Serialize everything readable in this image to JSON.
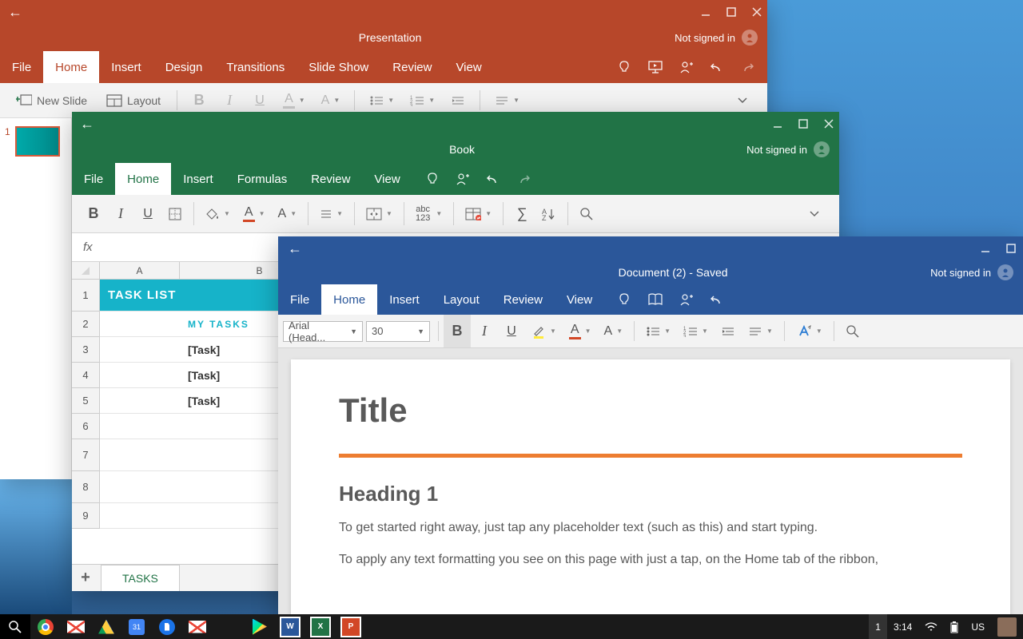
{
  "powerpoint": {
    "title": "Presentation",
    "signed": "Not signed in",
    "tabs": {
      "file": "File",
      "home": "Home",
      "insert": "Insert",
      "design": "Design",
      "transitions": "Transitions",
      "slideshow": "Slide Show",
      "review": "Review",
      "view": "View"
    },
    "new_slide": "New Slide",
    "layout": "Layout",
    "slide_number": "1"
  },
  "excel": {
    "title": "Book",
    "signed": "Not signed in",
    "tabs": {
      "file": "File",
      "home": "Home",
      "insert": "Insert",
      "formulas": "Formulas",
      "review": "Review",
      "view": "View"
    },
    "fx_label": "fx",
    "abc123": "abc\n123",
    "cols": {
      "a": "A",
      "b": "B"
    },
    "rows": {
      "r1": "1",
      "r2": "2",
      "r3": "3",
      "r4": "4",
      "r5": "5",
      "r6": "6",
      "r7": "7",
      "r8": "8",
      "r9": "9"
    },
    "task_list_header": "TASK LIST",
    "my_tasks": "MY  TASKS",
    "task": "[Task]",
    "sheet_name": "TASKS",
    "plus": "+"
  },
  "word": {
    "title": "Document (2)  -  Saved",
    "signed": "Not signed in",
    "tabs": {
      "file": "File",
      "home": "Home",
      "insert": "Insert",
      "layout": "Layout",
      "review": "Review",
      "view": "View"
    },
    "font_name": "Arial (Head...",
    "font_size": "30",
    "doc_title": "Title",
    "heading1": "Heading 1",
    "para1": "To get started right away, just tap any placeholder text (such as this) and start typing.",
    "para2": "To apply any text formatting you see on this page with just a tap, on the Home tab of the ribbon,"
  },
  "taskbar": {
    "cal_day": "31",
    "notif": "1",
    "time": "3:14",
    "lang": "US"
  }
}
